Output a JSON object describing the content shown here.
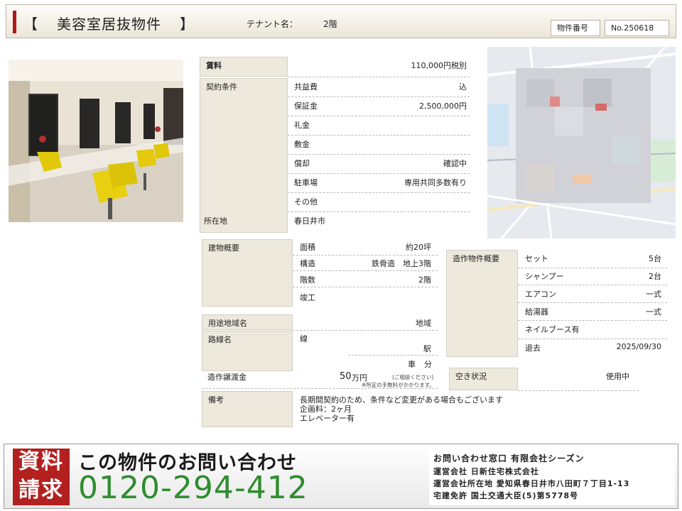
{
  "header": {
    "bracket_open": "【",
    "title": "美容室居抜物件",
    "bracket_close": "】",
    "tenant_label": "テナント名：",
    "tenant_value": "2階",
    "property_no_label": "物件番号",
    "property_no": "No.250618"
  },
  "rent": {
    "label": "賃料",
    "value": "110,000円税別"
  },
  "contract": {
    "label": "契約条件",
    "rows": [
      {
        "key": "共益費",
        "value": "込"
      },
      {
        "key": "保証金",
        "value": "2,500,000円"
      },
      {
        "key": "礼金",
        "value": ""
      },
      {
        "key": "敷金",
        "value": ""
      },
      {
        "key": "償却",
        "value": "確認中"
      },
      {
        "key": "駐車場",
        "value": "専用共同多数有り"
      },
      {
        "key": "その他",
        "value": ""
      }
    ]
  },
  "location": {
    "label": "所在地",
    "value": "春日井市"
  },
  "building": {
    "label": "建物概要",
    "rows": [
      {
        "key": "面積",
        "value": "約20坪"
      },
      {
        "key": "構造",
        "value": "鉄骨造　地上3階"
      },
      {
        "key": "階数",
        "value": "2階"
      },
      {
        "key": "竣工",
        "value": ""
      }
    ]
  },
  "zoning": {
    "label": "用途地域名",
    "value": "地域"
  },
  "route": {
    "label": "路線名",
    "line": "線",
    "station": "駅",
    "car": "車",
    "minutes": "分"
  },
  "transfer": {
    "label": "造作譲渡金",
    "amount": "50",
    "unit": "万円",
    "note1": "(ご相談ください)",
    "note2": "※所定の手数料がかかります。"
  },
  "notes": {
    "label": "備考",
    "lines": [
      "長期間契約のため、条件など変更がある場合もございます",
      "企画料：2ヶ月",
      "エレベーター有"
    ]
  },
  "fixtures": {
    "label": "造作物件概要",
    "rows": [
      {
        "key": "セット",
        "value": "5台"
      },
      {
        "key": "シャンプー",
        "value": "2台"
      },
      {
        "key": "エアコン",
        "value": "一式"
      },
      {
        "key": "給湯器",
        "value": "一式"
      },
      {
        "key": "ネイルブース有",
        "value": ""
      },
      {
        "key": "退去",
        "value": "2025/09/30"
      }
    ]
  },
  "vacancy": {
    "label": "空き状況",
    "value": "使用中"
  },
  "footer": {
    "seal_top": "資料",
    "seal_bottom": "請求",
    "title": "この物件のお問い合わせ",
    "phone": "0120-294-412",
    "company_lines": [
      "お問い合わせ窓口 有限会社シーズン",
      "運営会社 日新住宅株式会社",
      "運営会社所在地 愛知県春日井市八田町７丁目1-13",
      "宅建免許 国土交通大臣(5)第5778号"
    ]
  },
  "colors": {
    "accent_red": "#b01818",
    "phone_green": "#2f8c2f",
    "label_bg": "#eee9dd"
  },
  "images": {
    "photo": "salon-interior-photo",
    "map": "blurred-location-map"
  }
}
